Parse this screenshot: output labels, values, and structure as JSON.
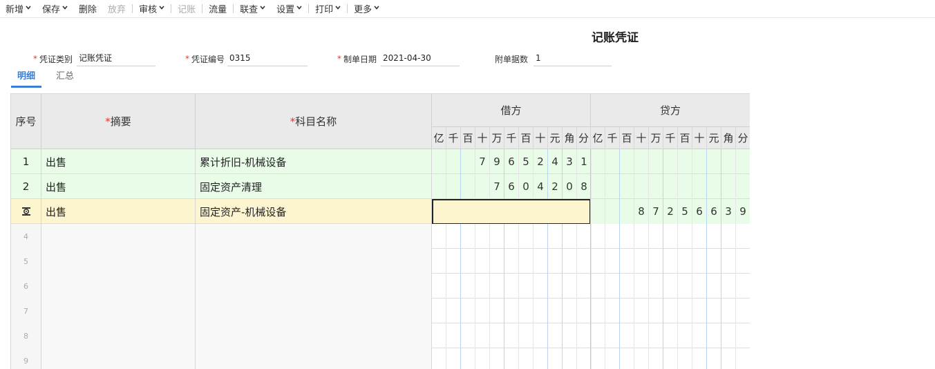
{
  "toolbar": {
    "items": [
      {
        "label": "新增",
        "dropdown": true,
        "disabled": false
      },
      {
        "label": "保存",
        "dropdown": true,
        "disabled": false
      },
      {
        "label": "删除",
        "dropdown": false,
        "disabled": false
      },
      {
        "label": "放弃",
        "dropdown": false,
        "disabled": true
      },
      {
        "label": "审核",
        "dropdown": true,
        "disabled": false
      },
      {
        "label": "记账",
        "dropdown": false,
        "disabled": true
      },
      {
        "label": "流量",
        "dropdown": false,
        "disabled": false
      },
      {
        "label": "联查",
        "dropdown": true,
        "disabled": false
      },
      {
        "label": "设置",
        "dropdown": true,
        "disabled": false
      },
      {
        "label": "打印",
        "dropdown": true,
        "disabled": false
      },
      {
        "label": "更多",
        "dropdown": true,
        "disabled": false
      }
    ]
  },
  "voucher": {
    "title": "记账凭证",
    "type_label": "凭证类别",
    "type_value": "记账凭证",
    "number_label": "凭证编号",
    "number_value": "0315",
    "date_label": "制单日期",
    "date_value": "2021-04-30",
    "attach_label": "附单据数",
    "attach_value": "1"
  },
  "tabs": {
    "detail": "明细",
    "summary": "汇总"
  },
  "grid": {
    "headers": {
      "seq": "序号",
      "summary": "摘要",
      "subject": "科目名称",
      "debit": "借方",
      "credit": "贷方",
      "star": "*"
    },
    "digit_units": [
      "亿",
      "千",
      "百",
      "十",
      "万",
      "千",
      "百",
      "十",
      "元",
      "角",
      "分"
    ],
    "rows": [
      {
        "seq": "1",
        "summary": "出售",
        "subject": "累计折旧-机械设备",
        "debit": "79652431",
        "credit": ""
      },
      {
        "seq": "2",
        "summary": "出售",
        "subject": "固定资产清理",
        "debit": "7604208",
        "credit": ""
      },
      {
        "seq": "",
        "summary": "出售",
        "subject": "固定资产-机械设备",
        "debit": "",
        "credit": "87256639"
      }
    ],
    "empty_rows": [
      "4",
      "5",
      "6",
      "7",
      "8",
      "9"
    ]
  },
  "colors": {
    "accent": "#3a7fd5",
    "required": "#e33333",
    "row_done": "#e8fce8",
    "row_active": "#fdf5cf"
  }
}
